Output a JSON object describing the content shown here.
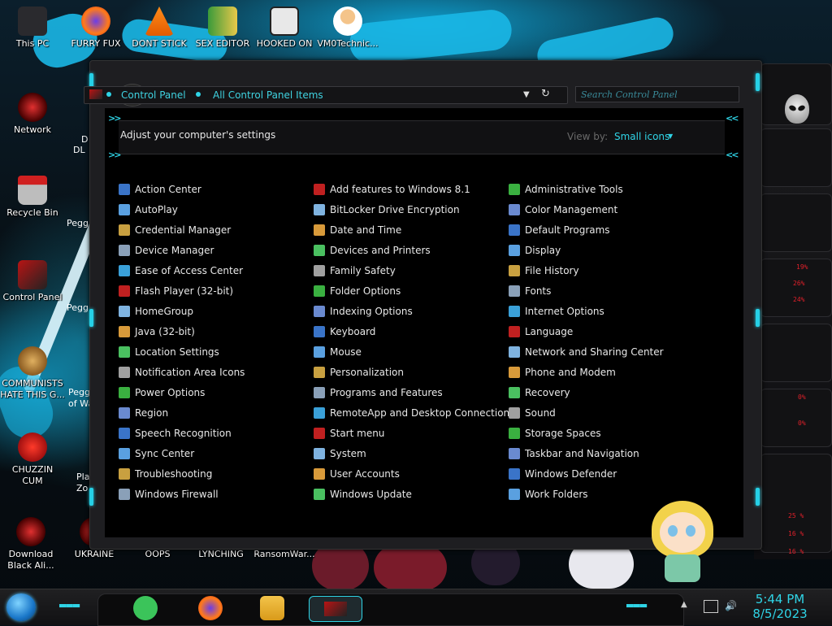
{
  "desktop": {
    "icons": [
      {
        "label": "This PC"
      },
      {
        "label": "FURRY FUX"
      },
      {
        "label": "DONT STICK"
      },
      {
        "label": "SEX EDITOR"
      },
      {
        "label": "HOOKED ON"
      },
      {
        "label": "VM0Technic..."
      },
      {
        "label": "Network"
      },
      {
        "label": "Recycle Bin"
      },
      {
        "label": "Control Panel"
      },
      {
        "label": "COMMUNISTS HATE THIS G..."
      },
      {
        "label": "CHUZZIN CUM"
      },
      {
        "label": "Download Black Ali..."
      },
      {
        "label": "UKRAINE"
      },
      {
        "label": "OOPS"
      },
      {
        "label": "LYNCHING"
      },
      {
        "label": "RansomWar..."
      }
    ],
    "partial_labels": [
      "D",
      "DL",
      "Peggl",
      "Peggl",
      "Pegg",
      "Peggl",
      "of Wa",
      "Pla",
      "Zo"
    ]
  },
  "window": {
    "breadcrumb": [
      "Control Panel",
      "All Control Panel Items"
    ],
    "search_placeholder": "Search Control Panel",
    "heading": "Adjust your computer's settings",
    "view_by_label": "View by:",
    "view_by_value": "Small icons",
    "items": {
      "col1": [
        "Action Center",
        "AutoPlay",
        "Credential Manager",
        "Device Manager",
        "Ease of Access Center",
        "Flash Player (32-bit)",
        "HomeGroup",
        "Java (32-bit)",
        "Location Settings",
        "Notification Area Icons",
        "Power Options",
        "Region",
        "Speech Recognition",
        "Sync Center",
        "Troubleshooting",
        "Windows Firewall"
      ],
      "col2": [
        "Add features to Windows 8.1",
        "BitLocker Drive Encryption",
        "Date and Time",
        "Devices and Printers",
        "Family Safety",
        "Folder Options",
        "Indexing Options",
        "Keyboard",
        "Mouse",
        "Personalization",
        "Programs and Features",
        "RemoteApp and Desktop Connections",
        "Start menu",
        "System",
        "User Accounts",
        "Windows Update"
      ],
      "col3": [
        "Administrative Tools",
        "Color Management",
        "Default Programs",
        "Display",
        "File History",
        "Fonts",
        "Internet Options",
        "Language",
        "Network and Sharing Center",
        "Phone and Modem",
        "Recovery",
        "Sound",
        "Storage Spaces",
        "Taskbar and Navigation",
        "Windows Defender",
        "Work Folders"
      ]
    }
  },
  "side_panel": {
    "readouts": [
      "19%",
      "26%",
      "24%",
      "0%",
      "0%",
      "25 %",
      "16 %",
      "16 %"
    ]
  },
  "taskbar": {
    "time": "5:44 PM",
    "date": "8/5/2023"
  },
  "colors": {
    "accent": "#2fd4e6",
    "wallpaper_blue": "#19b7e6",
    "panel_red": "#e0202a"
  }
}
